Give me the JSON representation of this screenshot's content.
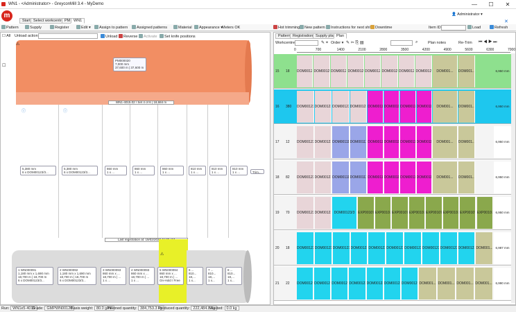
{
  "window": {
    "title": "WN1 - <Administrator> - GreyconMill 3.4 - MyDemo",
    "controls": [
      "—",
      "☐",
      "✕"
    ]
  },
  "app": {
    "logo": "m",
    "user_label": "Administrator"
  },
  "tabs": [
    {
      "label": "Start"
    },
    {
      "label": "Select workcentre"
    },
    {
      "label": "PM"
    },
    {
      "label": "WN1"
    }
  ],
  "left_toolbar": [
    "Pattern",
    "Supply",
    "Register",
    "Edit",
    "Assign to pattern",
    "Assigned patterns",
    "Material",
    "Appearance",
    "Meters OK"
  ],
  "right_toolbar": [
    "Hot trimming",
    "New pattern",
    "Instructions for next shift",
    "Downtime"
  ],
  "item_id": {
    "label": "Item ID:",
    "value": ""
  },
  "right_actions": [
    "Load",
    "Refresh"
  ],
  "left_panel": {
    "all_checkbox": "All",
    "unload_action_label": "Unload action",
    "unload_buttons": [
      "Unload",
      "Reverse",
      "Activate",
      "Set knife positions"
    ],
    "parent_roll": {
      "id": "PM000020",
      "line1": "7,000 mm",
      "line2": "37,600 m | 37,600 m"
    },
    "set_header": "WN1-4015.02 / Set 4 of 6 | 18,684 m",
    "slit_cards": [
      {
        "line1": "5,380 mm",
        "line2": "6 x DOM00123/3..."
      },
      {
        "line1": "5,380 mm",
        "line2": "6 x DOM00123/3..."
      },
      {
        "line1": "860 mm",
        "line2": "1 x ..."
      },
      {
        "line1": "860 mm",
        "line2": "1 x ..."
      },
      {
        "line1": "860 mm",
        "line2": "1 x ..."
      },
      {
        "line1": "810 mm",
        "line2": "1 x ..."
      },
      {
        "line1": "810 mm",
        "line2": "1 x ..."
      },
      {
        "line1": "810 mm",
        "line2": "1 x ..."
      }
    ],
    "trim_label": "Trim...",
    "last_registration": "Last registration at: 19/02/2022 11:32 AM",
    "reels": [
      {
        "id": "1 WN000091",
        "l1": "1,180 mm x 1,690 mm",
        "l2": "18,700 m | 18,700 m",
        "l3": "6 x DOM00123/3..."
      },
      {
        "id": "2 WN000092",
        "l1": "1,180 mm x 1,690 mm",
        "l2": "18,700 m | 18,700 m",
        "l3": "6 x DOM00123/3..."
      },
      {
        "id": "3 WN000093",
        "l1": "860 mm x ...",
        "l2": "18,700 m | ...",
        "l3": "1 x ..."
      },
      {
        "id": "4 WN000093",
        "l1": "860 mm x ...",
        "l2": "18,700 m | ...",
        "l3": "1 x ..."
      },
      {
        "id": "5 WN000094",
        "l1": "860 mm x ...",
        "l2": "18,700 m | ...",
        "l3": "On-Hold / Free ..."
      },
      {
        "id": "6 ...",
        "l1": "810...",
        "l2": "18,...",
        "l3": "1 x..."
      },
      {
        "id": "7 ...",
        "l1": "810...",
        "l2": "18,...",
        "l3": "1 x..."
      },
      {
        "id": "8 ...",
        "l1": "810...",
        "l2": "18,...",
        "l3": "1 x..."
      }
    ]
  },
  "right_panel": {
    "subtabs": [
      "Pattern",
      "Registrations",
      "Supply plan",
      "Plan"
    ],
    "workcentre_label": "Workcentre",
    "order_label": "Order",
    "plan_notes_label": "Plan notes",
    "re_trim_label": "Re-Trim",
    "ruler": [
      "0",
      "700",
      "1400",
      "2100",
      "2800",
      "3500",
      "4200",
      "4900",
      "5600",
      "6300",
      "7000 mm"
    ],
    "rows": [
      {
        "a": "15",
        "b": "18",
        "right": "6,950 mm",
        "bands": [
          [
            "#e8d5d8",
            0,
            0.69,
            "DOM00123/3"
          ],
          [
            "#c9c89a",
            0.69,
            0.82,
            "DOM001..."
          ],
          [
            "#c9c89a",
            0.82,
            0.91,
            "DOM001..."
          ]
        ]
      },
      {
        "a": "16",
        "b": "380",
        "right": "6,950 mm",
        "bands": [
          [
            "#e8d5d8",
            0,
            0.36,
            "DOM00123/3"
          ],
          [
            "#ee1ecf",
            0.36,
            0.69,
            "DOM00111/1"
          ],
          [
            "#c9c89a",
            0.69,
            0.82,
            "DOM001..."
          ],
          [
            "#c9c89a",
            0.82,
            0.91,
            "DOM001..."
          ]
        ]
      },
      {
        "a": "17",
        "b": "12",
        "right": "6,950 mm",
        "bands": [
          [
            "#e8d5d8",
            0,
            0.18,
            "DOM00123/3"
          ],
          [
            "#9aa6e8",
            0.18,
            0.36,
            "DOM00111/1"
          ],
          [
            "#ee1ecf",
            0.36,
            0.69,
            "DOM00111/1"
          ],
          [
            "#c9c89a",
            0.69,
            0.82,
            "DOM001..."
          ],
          [
            "#c9c89a",
            0.82,
            0.91,
            "DOM001..."
          ]
        ]
      },
      {
        "a": "18",
        "b": "82",
        "right": "6,950 mm",
        "bands": [
          [
            "#e8d5d8",
            0,
            0.18,
            "DOM00123/3"
          ],
          [
            "#9aa6e8",
            0.18,
            0.36,
            "DOM00111/1"
          ],
          [
            "#ee1ecf",
            0.36,
            0.69,
            "DOM00111/1"
          ],
          [
            "#c9c89a",
            0.69,
            0.82,
            "DOM001..."
          ],
          [
            "#c9c89a",
            0.82,
            0.91,
            "DOM001..."
          ]
        ]
      },
      {
        "a": "19",
        "b": "70",
        "right": "6,950 mm",
        "bands": [
          [
            "#e8d5d8",
            0,
            0.18,
            "DOM00123/3"
          ],
          [
            "#22d4ee",
            0.18,
            0.31,
            "DOM00123/3"
          ],
          [
            "#8aa84c",
            0.31,
            1.0,
            "EXP00107B1/1"
          ]
        ]
      },
      {
        "a": "20",
        "b": "18",
        "right": "6,987 mm",
        "bands": [
          [
            "#22d4ee",
            0,
            0.91,
            "DOM00123/3"
          ],
          [
            "#c9c89a",
            0.91,
            1.0,
            "DOM001..."
          ]
        ]
      },
      {
        "a": "21",
        "b": "22",
        "right": "6,990 mm",
        "bands": [
          [
            "#22d4ee",
            0,
            0.62,
            "DOM00123/3"
          ],
          [
            "#c9c89a",
            0.62,
            1.0,
            "DOM001..."
          ]
        ]
      }
    ]
  },
  "status_bar": {
    "run_label": "Run:",
    "run_value": "WN1e5-4015",
    "grade_label": "Grade:",
    "grade_value": "GMPWN00120",
    "basis_label": "Basis weight:",
    "basis_value": "80.0 g/m²",
    "planned_label": "Planned quantity:",
    "planned_value": "384,753.3 kg",
    "produced_label": "Produced quantity:",
    "produced_value": "222,484.8 kg",
    "wasted_label": "Wasted:",
    "wasted_value": "0.0 kg"
  },
  "colors": {
    "accent": "#d8261d",
    "parent_roll": "#f28e63",
    "green": "#8ee08e",
    "cyan": "#1ec7ee",
    "yellow": "#e8f028"
  }
}
